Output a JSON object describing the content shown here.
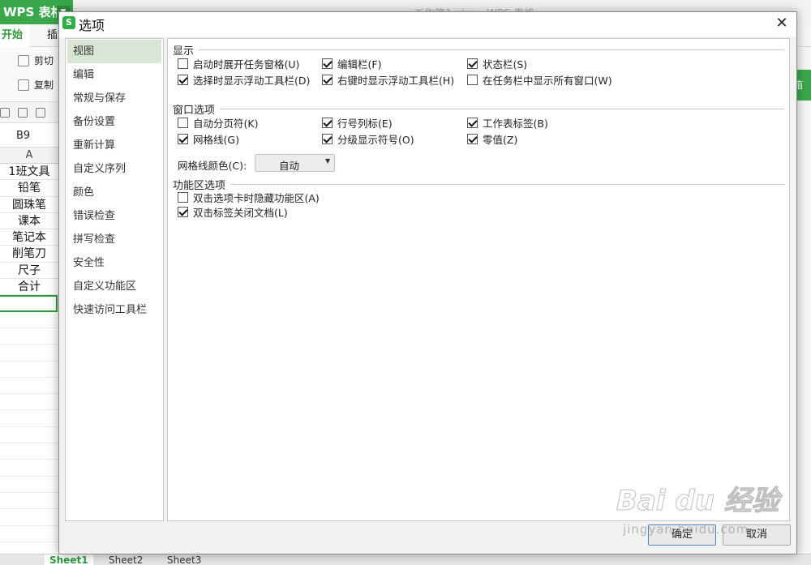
{
  "app": {
    "name": "WPS 表格",
    "doc_title": "工作簿1.xlsx - WPS 表格",
    "tabs": [
      "开始",
      "插"
    ],
    "ribbon": {
      "cut": "剪切",
      "copy": "复制",
      "right_btn": "箱"
    },
    "name_box": "B9",
    "column_header": "A",
    "cells": [
      "1班文具",
      "铅笔",
      "圆珠笔",
      "课本",
      "笔记本",
      "削笔刀",
      "尺子",
      "合计"
    ],
    "sheets": [
      "Sheet1",
      "Sheet2",
      "Sheet3"
    ]
  },
  "dialog": {
    "logo": "S",
    "title": "选项",
    "close_icon": "✕",
    "nav": [
      "视图",
      "编辑",
      "常规与保存",
      "备份设置",
      "重新计算",
      "自定义序列",
      "颜色",
      "错误检查",
      "拼写检查",
      "安全性",
      "自定义功能区",
      "快速访问工具栏"
    ],
    "sections": {
      "display": {
        "title": "显示",
        "options": [
          {
            "label": "启动时展开任务窗格(U)",
            "checked": false
          },
          {
            "label": "编辑栏(F)",
            "checked": true
          },
          {
            "label": "状态栏(S)",
            "checked": true
          },
          {
            "label": "选择时显示浮动工具栏(D)",
            "checked": true
          },
          {
            "label": "右键时显示浮动工具栏(H)",
            "checked": true
          },
          {
            "label": "在任务栏中显示所有窗口(W)",
            "checked": false
          }
        ]
      },
      "window": {
        "title": "窗口选项",
        "options": [
          {
            "label": "自动分页符(K)",
            "checked": false
          },
          {
            "label": "行号列标(E)",
            "checked": true
          },
          {
            "label": "工作表标签(B)",
            "checked": true
          },
          {
            "label": "网格线(G)",
            "checked": true
          },
          {
            "label": "分级显示符号(O)",
            "checked": true
          },
          {
            "label": "零值(Z)",
            "checked": true
          }
        ],
        "grid_color_label": "网格线颜色(C):",
        "grid_color_value": "自动"
      },
      "ribbon": {
        "title": "功能区选项",
        "options": [
          {
            "label": "双击选项卡时隐藏功能区(A)",
            "checked": false
          },
          {
            "label": "双击标签关闭文档(L)",
            "checked": true
          }
        ]
      }
    },
    "buttons": {
      "ok": "确定",
      "cancel": "取消"
    }
  },
  "watermark": {
    "text": "Bai du 经验",
    "sub": "jingyan.baidu.com"
  }
}
